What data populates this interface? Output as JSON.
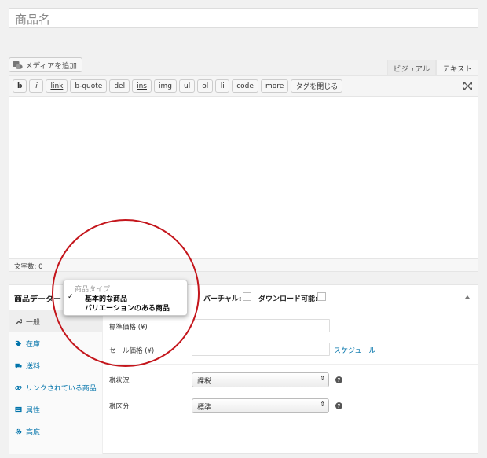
{
  "title_field": {
    "value": "商品名"
  },
  "media": {
    "label": "メディアを追加"
  },
  "editor_tabs": [
    {
      "label": "ビジュアル",
      "active": false
    },
    {
      "label": "テキスト",
      "active": true
    }
  ],
  "quicktags": [
    "b",
    "i",
    "link",
    "b-quote",
    "del",
    "ins",
    "img",
    "ul",
    "ol",
    "li",
    "code",
    "more",
    "タグを閉じる"
  ],
  "status": {
    "word_count": "文字数: 0"
  },
  "product_panel": {
    "title": "商品データー",
    "virtual_label": "バーチャル:",
    "downloadable_label": "ダウンロード可能:",
    "tabs": [
      {
        "label": "一般",
        "icon": "wrench-icon",
        "active": true
      },
      {
        "label": "在庫",
        "icon": "tag-icon",
        "active": false
      },
      {
        "label": "送料",
        "icon": "truck-icon",
        "active": false
      },
      {
        "label": "リンクされている商品",
        "icon": "link-icon",
        "active": false
      },
      {
        "label": "属性",
        "icon": "list-icon",
        "active": false
      },
      {
        "label": "高度",
        "icon": "gear-icon",
        "active": false
      }
    ],
    "fields": {
      "regular_price_label": "標準価格 (¥)",
      "sale_price_label": "セール価格 (¥)",
      "schedule_label": "スケジュール",
      "tax_status_label": "税状況",
      "tax_status_value": "課税",
      "tax_class_label": "税区分",
      "tax_class_value": "標準"
    },
    "product_type_dropdown": {
      "header": "商品タイプ",
      "options": [
        {
          "label": "基本的な商品",
          "selected": true
        },
        {
          "label": "バリエーションのある商品",
          "selected": false
        }
      ]
    }
  },
  "colors": {
    "link": "#0073aa",
    "highlight": "#c4161c"
  }
}
